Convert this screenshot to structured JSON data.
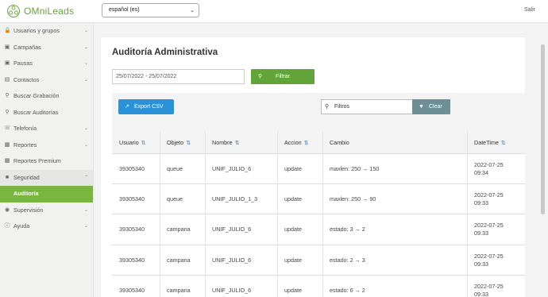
{
  "topbar": {
    "logo_text": "OMniLeads",
    "language_value": "español (es)",
    "logout_label": "Salir"
  },
  "sidebar": {
    "items": [
      {
        "label": "Usuarios y grupos",
        "icon": "lock-icon",
        "has_chevron": true
      },
      {
        "label": "Campañas",
        "icon": "folder-icon",
        "has_chevron": true
      },
      {
        "label": "Pausas",
        "icon": "folder-icon",
        "has_chevron": true
      },
      {
        "label": "Contactos",
        "icon": "contacts-icon",
        "has_chevron": true
      },
      {
        "label": "Buscar Grabación",
        "icon": "search-icon",
        "has_chevron": false
      },
      {
        "label": "Buscar Auditorías",
        "icon": "search-icon",
        "has_chevron": false
      },
      {
        "label": "Telefonía",
        "icon": "phone-icon",
        "has_chevron": true
      },
      {
        "label": "Reportes",
        "icon": "chart-icon",
        "has_chevron": true
      },
      {
        "label": "Reportes Premium",
        "icon": "chart-icon",
        "has_chevron": false
      },
      {
        "label": "Seguridad",
        "icon": "shield-icon",
        "has_chevron": true
      },
      {
        "label": "Auditoría",
        "icon": "",
        "has_chevron": false
      },
      {
        "label": "Supervisión",
        "icon": "eye-icon",
        "has_chevron": true
      },
      {
        "label": "Ayuda",
        "icon": "help-icon",
        "has_chevron": true
      }
    ]
  },
  "main": {
    "title": "Auditoría Administrativa",
    "date_range": "25/07/2022 - 25/07/2022",
    "filter_label": "Filtrar",
    "export_label": "Export CSV",
    "search_value": "Filtros",
    "clear_label": "Clear",
    "columns": [
      "Usuario",
      "Objeto",
      "Nombre",
      "Accion",
      "Cambio",
      "DateTime"
    ],
    "rows": [
      {
        "usuario": "39305340",
        "objeto": "queue",
        "nombre": "UNIF_JULIO_6",
        "accion": "update",
        "cambio": "maxlen: 250 → 150",
        "date": "2022-07-25",
        "time": "09:34"
      },
      {
        "usuario": "39305340",
        "objeto": "queue",
        "nombre": "UNIF_JULIO_1_3",
        "accion": "update",
        "cambio": "maxlen: 250 → 90",
        "date": "2022-07-25",
        "time": "09:33"
      },
      {
        "usuario": "39305340",
        "objeto": "campana",
        "nombre": "UNIF_JULIO_6",
        "accion": "update",
        "cambio": "estado: 3 → 2",
        "date": "2022-07-25",
        "time": "09:33"
      },
      {
        "usuario": "39305340",
        "objeto": "campana",
        "nombre": "UNIF_JULIO_6",
        "accion": "update",
        "cambio": "estado: 2 → 3",
        "date": "2022-07-25",
        "time": "09:33"
      },
      {
        "usuario": "39305340",
        "objeto": "campana",
        "nombre": "UNIF_JULIO_6",
        "accion": "update",
        "cambio": "estado: 6 → 2",
        "date": "2022-07-25",
        "time": "09:33"
      }
    ]
  },
  "colors": {
    "brand_green": "#62a43a",
    "export_blue": "#2b92d7",
    "clear_gray": "#6d8f96"
  }
}
